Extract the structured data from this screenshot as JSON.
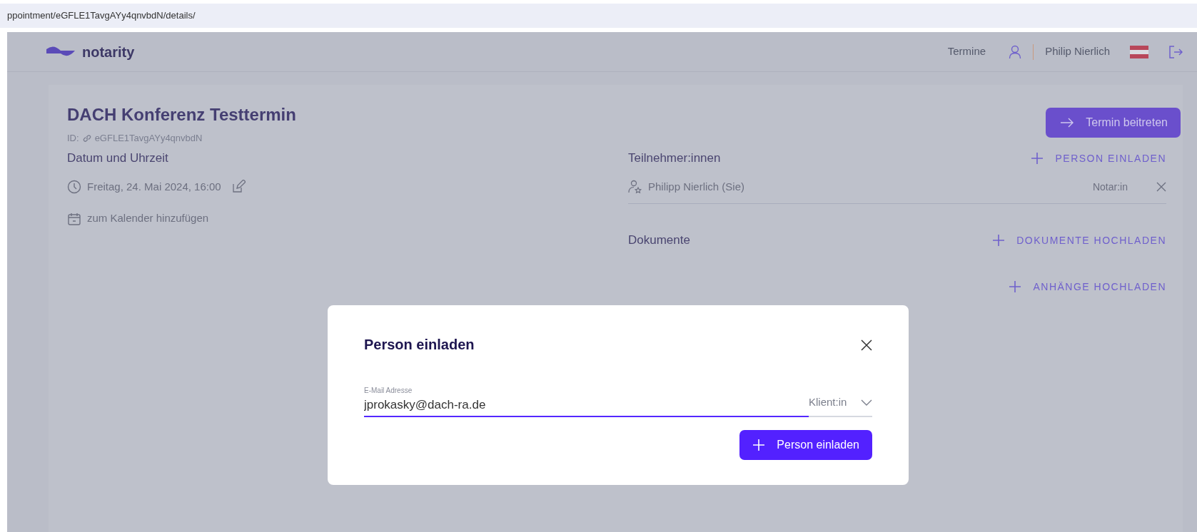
{
  "browser": {
    "url": "ppointment/eGFLE1TavgAYy4qnvbdN/details/"
  },
  "header": {
    "logo": "notarity",
    "nav": "Termine",
    "user": "Philip Nierlich"
  },
  "appointment": {
    "title": "DACH Konferenz Testtermin",
    "id_label": "ID:",
    "id": "eGFLE1TavgAYy4qnvbdN",
    "join_button": "Termin beitreten"
  },
  "schedule": {
    "heading": "Datum und Uhrzeit",
    "datetime": "Freitag, 24. Mai 2024, 16:00",
    "calendar_link": "zum Kalender hinzufügen"
  },
  "participants": {
    "heading": "Teilnehmer:innen",
    "invite_button": "PERSON EINLADEN",
    "items": [
      {
        "name": "Philipp Nierlich (Sie)",
        "role": "Notar:in"
      }
    ]
  },
  "documents": {
    "heading": "Dokumente",
    "upload_button": "DOKUMENTE HOCHLADEN",
    "attachments_button": "ANHÄNGE HOCHLADEN"
  },
  "modal": {
    "title": "Person einladen",
    "email_label": "E-Mail Adresse",
    "email_value": "jprokasky@dach-ra.de",
    "email_focused": true,
    "role": "Klient:in",
    "submit": "Person einladen"
  }
}
